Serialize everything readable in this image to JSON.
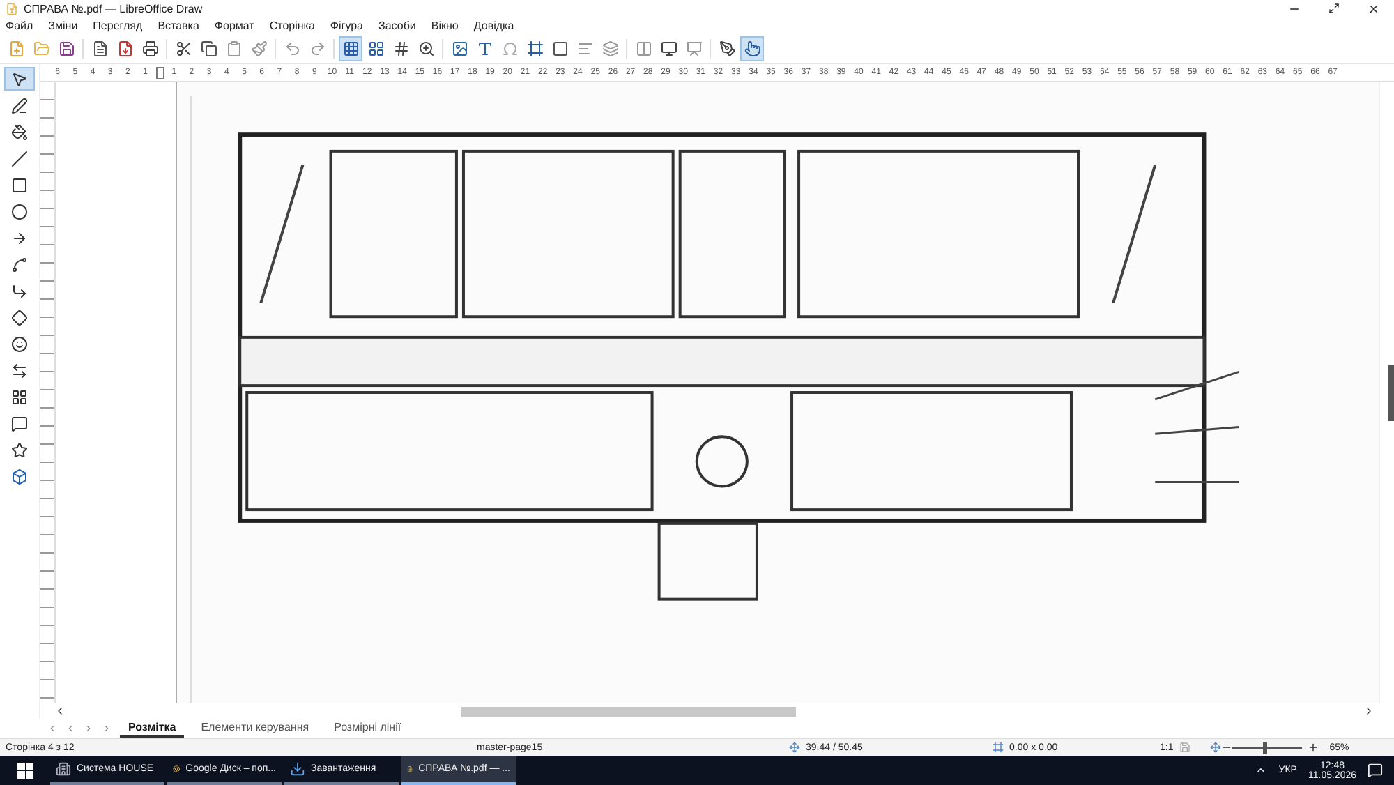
{
  "window": {
    "title": "СПРАВА №.pdf — LibreOffice Draw"
  },
  "menu": [
    "Файл",
    "Зміни",
    "Перегляд",
    "Вставка",
    "Формат",
    "Сторінка",
    "Фігура",
    "Засоби",
    "Вікно",
    "Довідка"
  ],
  "toolbar": [
    {
      "selected": false
    },
    {
      "selected": false
    },
    {
      "selected": false
    },
    {
      "selected": false
    },
    {
      "selected": false
    },
    {
      "selected": false
    },
    {
      "selected": false
    },
    {
      "selected": false
    },
    {
      "selected": false
    },
    {
      "selected": false
    },
    {
      "selected": false
    },
    {
      "selected": false
    },
    {
      "selected": true
    },
    {
      "selected": false
    },
    {
      "selected": false
    },
    {
      "selected": false
    },
    {
      "selected": false
    },
    {
      "selected": false
    },
    {
      "selected": false
    },
    {
      "selected": false
    },
    {
      "selected": false
    },
    {
      "selected": false
    },
    {
      "selected": false
    },
    {
      "selected": false
    },
    {
      "selected": false
    },
    {
      "selected": false
    },
    {
      "selected": false
    },
    {
      "selected": true
    }
  ],
  "drawing_tools": [
    {
      "selected": true
    },
    {
      "selected": false
    },
    {
      "selected": false
    },
    {
      "selected": false
    },
    {
      "selected": false
    },
    {
      "selected": false
    },
    {
      "selected": false
    },
    {
      "selected": false
    },
    {
      "selected": false
    },
    {
      "selected": false
    },
    {
      "selected": false
    },
    {
      "selected": false
    },
    {
      "selected": false
    },
    {
      "selected": false
    },
    {
      "selected": false
    },
    {
      "selected": false
    }
  ],
  "ruler": {
    "left_marks": [
      "6",
      "5",
      "4",
      "3",
      "2",
      "1"
    ],
    "right_marks": [
      "1",
      "2",
      "3",
      "4",
      "5",
      "6",
      "7",
      "8",
      "9",
      "10",
      "11",
      "12",
      "13",
      "14",
      "15",
      "16",
      "17",
      "18",
      "19",
      "20",
      "21",
      "22",
      "23",
      "24",
      "25",
      "26",
      "27",
      "28",
      "29",
      "30",
      "31",
      "32",
      "33",
      "34",
      "35",
      "36",
      "37",
      "38",
      "39",
      "40",
      "41",
      "42",
      "43",
      "44",
      "45",
      "46",
      "47",
      "48",
      "49",
      "50",
      "51",
      "52",
      "53",
      "54",
      "55",
      "56",
      "57",
      "58",
      "59",
      "60",
      "61",
      "62",
      "63",
      "64",
      "65",
      "66",
      "67"
    ]
  },
  "sheet_tabs": [
    {
      "label": "Розмітка",
      "selected": true
    },
    {
      "label": "Елементи керування",
      "selected": false
    },
    {
      "label": "Розмірні лінії",
      "selected": false
    }
  ],
  "status_bar": {
    "page": "Сторінка 4 з 12",
    "master": "master-page15",
    "position": "39.44 / 50.45",
    "size": "0.00 x 0.00",
    "scale": "1:1",
    "zoom": "65%",
    "zoom_slider": {
      "level": 0.45
    }
  },
  "taskbar": [
    {
      "label": "Система HOUSE",
      "selected": false
    },
    {
      "label": "Google Диск – поп...",
      "selected": false
    },
    {
      "label": "Завантаження",
      "selected": false
    },
    {
      "label": "СПРАВА №.pdf — ...",
      "selected": true
    }
  ],
  "tray": {
    "language": "УКР",
    "time": "12:48",
    "date": "11.05.2026"
  }
}
